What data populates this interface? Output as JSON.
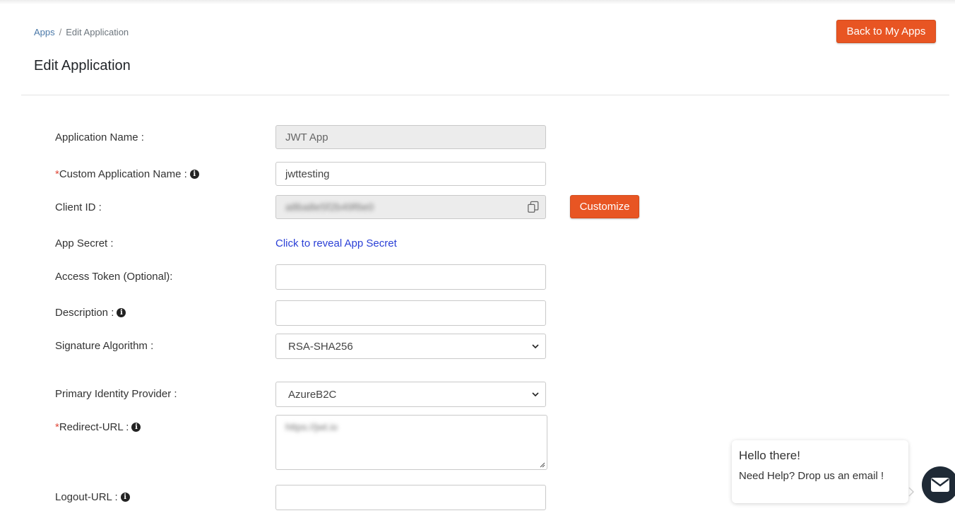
{
  "breadcrumb": {
    "parent": "Apps",
    "separator": "/",
    "current": "Edit Application"
  },
  "header": {
    "title": "Edit Application",
    "back_button": "Back to My Apps"
  },
  "colors": {
    "accent": "#e85523",
    "link": "#2a3fd6",
    "required": "#e04a3a"
  },
  "form": {
    "application_name": {
      "label": "Application Name :",
      "value": "JWT App"
    },
    "custom_name": {
      "required_mark": "*",
      "label": "Custom Application Name :",
      "value": "jwttesting"
    },
    "client_id": {
      "label": "Client ID :",
      "value": "a8ba8e5f2b49f6e0",
      "copy_icon": "copy-icon"
    },
    "customize_button": "Customize",
    "app_secret": {
      "label": "App Secret :",
      "link": "Click to reveal App Secret"
    },
    "access_token": {
      "label": "Access Token (Optional):",
      "value": ""
    },
    "description": {
      "label": "Description :",
      "value": ""
    },
    "signature_algorithm": {
      "label": "Signature Algorithm :",
      "value": "RSA-SHA256"
    },
    "primary_idp": {
      "label": "Primary Identity Provider :",
      "value": "AzureB2C"
    },
    "redirect_url": {
      "required_mark": "*",
      "label": "Redirect-URL :",
      "value": "https://jwt.io"
    },
    "logout_url": {
      "label": "Logout-URL :",
      "value": ""
    }
  },
  "chat": {
    "title": "Hello there!",
    "subtitle": "Need Help? Drop us an email !",
    "icon": "mail-icon"
  }
}
